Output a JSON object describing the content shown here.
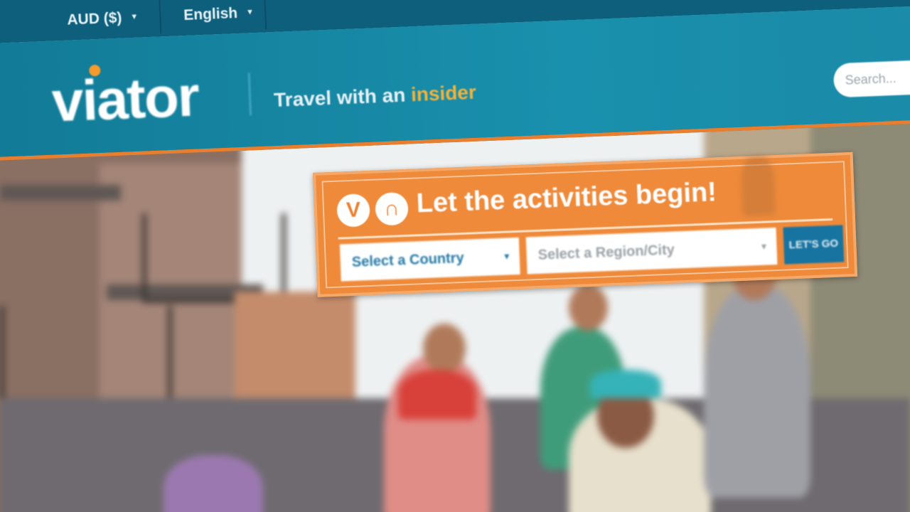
{
  "utility_bar": {
    "currency": "AUD ($)",
    "language": "English"
  },
  "header": {
    "logo_text": "viator",
    "tagline_prefix": "Travel with an",
    "tagline_accent": "insider",
    "search_placeholder": "Search..."
  },
  "widget": {
    "badge_1": "V",
    "badge_2": "∩",
    "title": "Let the activities begin!",
    "country_select": "Select a Country",
    "region_select": "Select a Region/City",
    "go_button": "LET'S GO"
  },
  "colors": {
    "brand_teal": "#12829f",
    "utility_teal": "#0d5f7c",
    "accent_orange": "#ee8a3a",
    "tagline_accent": "#f2b33d",
    "go_button_blue": "#1773a0"
  },
  "icons": {
    "currency_caret": "chevron-down-icon",
    "language_caret": "chevron-down-icon",
    "select_arrow": "chevron-down-icon",
    "logo_dot": "orange-dot-icon"
  }
}
